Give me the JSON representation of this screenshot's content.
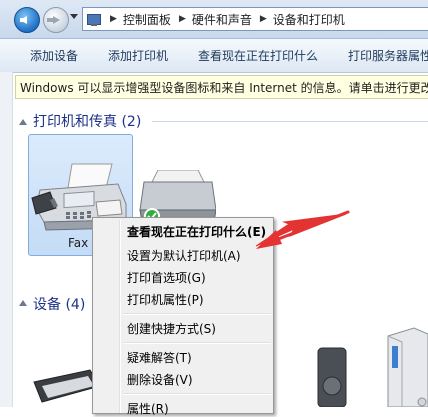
{
  "breadcrumb": {
    "items": [
      "控制面板",
      "硬件和声音",
      "设备和打印机"
    ],
    "separator": "▶"
  },
  "command_bar": {
    "items": [
      "添加设备",
      "添加打印机",
      "查看现在正在打印什么",
      "打印服务器属性"
    ]
  },
  "info_bar": {
    "text": "Windows 可以显示增强型设备图标和来自 Internet 的信息。请单击进行更改"
  },
  "groups": {
    "printers": {
      "title": "打印机和传真 (2)"
    },
    "devices": {
      "title": "设备 (4)"
    }
  },
  "fax": {
    "label": "Fax"
  },
  "context_menu": {
    "items": [
      "查看现在正在打印什么(E)",
      "设置为默认打印机(A)",
      "打印首选项(G)",
      "打印机属性(P)",
      "创建快捷方式(S)",
      "疑难解答(T)",
      "删除设备(V)",
      "属性(R)"
    ]
  },
  "colors": {
    "annotation_arrow": "#e33333",
    "group_header": "#1e3287",
    "info_bar_bg": "#ffffe1"
  }
}
